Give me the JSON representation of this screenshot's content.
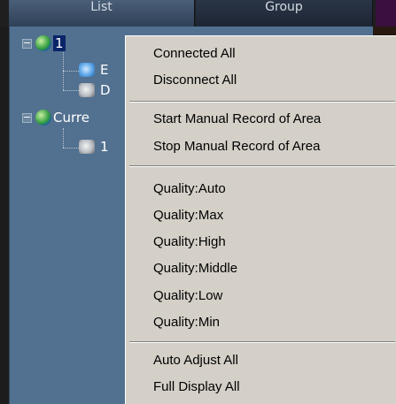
{
  "tabs": {
    "list": "List",
    "group": "Group"
  },
  "tree": {
    "root1_label": "1",
    "child1_label": "E",
    "child2_label": "D",
    "root2_label": "Curre",
    "root2_child_label": "1"
  },
  "menu": {
    "connected_all": "Connected All",
    "disconnect_all": "Disconnect All",
    "start_manual": "Start Manual Record of Area",
    "stop_manual": "Stop Manual Record of Area",
    "quality_auto": "Quality:Auto",
    "quality_max": "Quality:Max",
    "quality_high": "Quality:High",
    "quality_middle": "Quality:Middle",
    "quality_low": "Quality:Low",
    "quality_min": "Quality:Min",
    "auto_adjust_all": "Auto Adjust All",
    "full_display_all": "Full Display All"
  },
  "colors": {
    "panel_bg": "#52708f",
    "menu_bg": "#d4d0c8",
    "selection": "#0a246a"
  }
}
